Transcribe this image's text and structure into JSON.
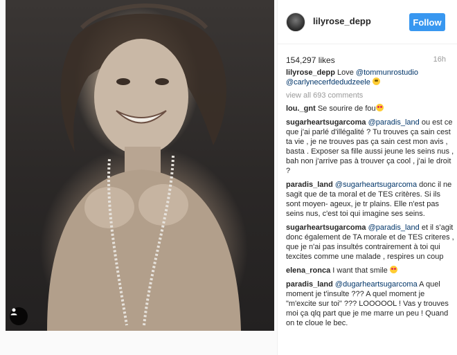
{
  "post": {
    "username": "lilyrose_depp",
    "follow_label": "Follow",
    "likes": "154,297 likes",
    "time": "16h"
  },
  "caption": {
    "author": "lilyrose_depp",
    "text_before": "Love ",
    "mention1": "@tommunrostudio",
    "mention2": "@carlynecerfdedudzeele",
    "emoji": "grin-icon"
  },
  "view_all": "view all 693 comments",
  "comments": [
    {
      "author": "lou._gnt",
      "text": "Se sourire de fou",
      "emoji": "heart-eyes-icon"
    },
    {
      "author": "sugarheartsugarcoma",
      "mention": "@paradis_land",
      "text": "ou est ce que j'ai parlé d'illégalité ? Tu trouves ça sain cest ta vie , je ne trouves pas ça sain cest mon avis , basta . Exposer sa fille aussi jeune les seins nus , bah non j'arrive pas à trouver ça cool , j'ai le droit ?"
    },
    {
      "author": "paradis_land",
      "mention": "@sugarheartsugarcoma",
      "text": "donc il ne sagit que de ta moral et de TES critères. Si ils sont moyen- ageux, je tr plains. Elle n'est pas seins nus, c'est toi qui imagine ses seins."
    },
    {
      "author": "sugarheartsugarcoma",
      "mention": "@paradis_land",
      "text": "et il s'agit donc également de TA morale et de TES criteres , que je n'ai pas insultés contrairement à toi qui texcites comme une malade , respires un coup"
    },
    {
      "author": "elena_ronca",
      "text": "I want that smile",
      "emoji": "heart-eyes-icon"
    },
    {
      "author": "paradis_land",
      "mention": "@dugarheartsugarcoma",
      "text": "A quel moment je t'insulte ??? A quel moment je \"m'excite sur toi\" ??? LOOOOOL ! Vas y trouves moi ça qlq part que je me marre un peu ! Quand on te cloue le bec."
    }
  ],
  "colors": {
    "accent": "#3897f0",
    "mention": "#003569",
    "muted": "#999999"
  }
}
